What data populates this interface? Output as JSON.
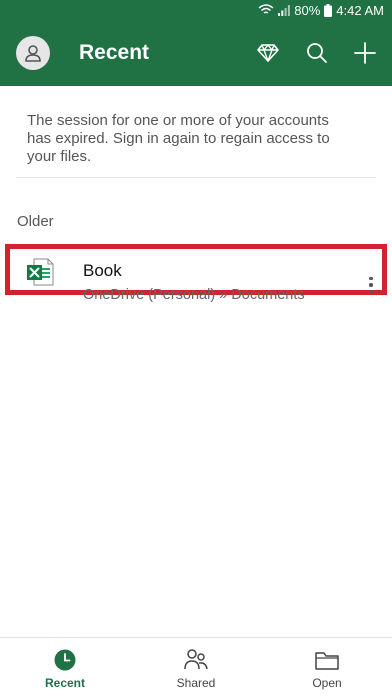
{
  "status_bar": {
    "battery": "80%",
    "time": "4:42 AM",
    "icons": [
      "wifi-icon",
      "signal-icon",
      "battery-icon"
    ]
  },
  "app_bar": {
    "title": "Recent",
    "actions": [
      "premium-diamond-icon",
      "search-icon",
      "add-icon"
    ],
    "color": "#207245"
  },
  "notice": {
    "text": "The session for one or more of your accounts has expired.  Sign in again to regain access to your files."
  },
  "sections": [
    {
      "label": "Older",
      "files": [
        {
          "name": "Book",
          "location": "OneDrive (Personal) » Documents",
          "icon": "excel-file-icon"
        }
      ]
    }
  ],
  "highlight_color": "#d2222d",
  "bottom_nav": {
    "items": [
      {
        "label": "Recent",
        "icon": "clock-icon",
        "active": true
      },
      {
        "label": "Shared",
        "icon": "people-icon",
        "active": false
      },
      {
        "label": "Open",
        "icon": "folder-icon",
        "active": false
      }
    ]
  }
}
